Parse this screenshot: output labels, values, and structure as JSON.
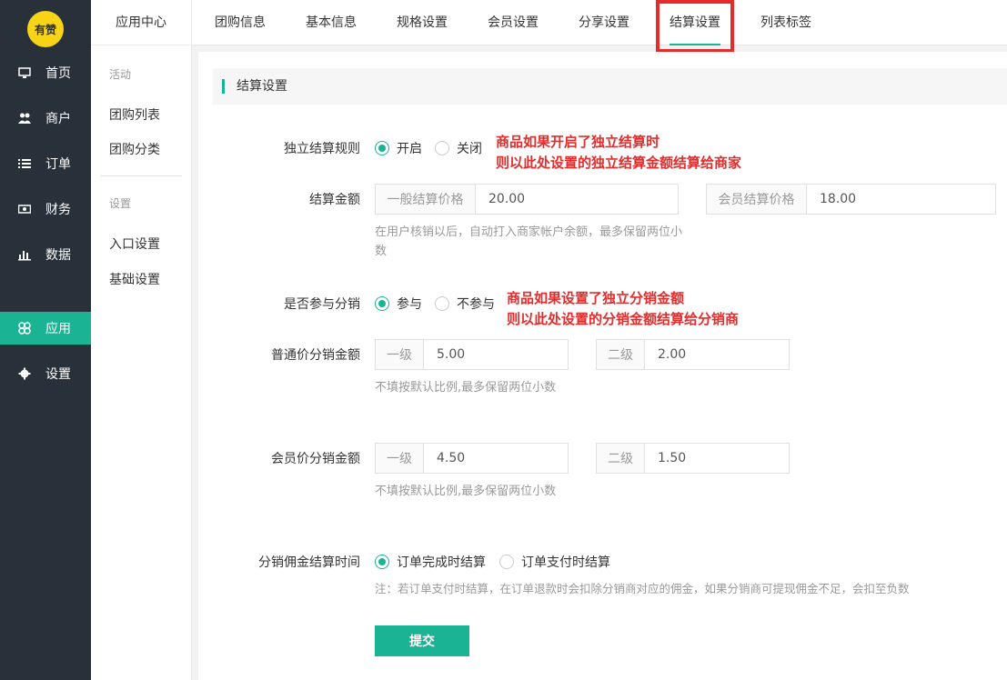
{
  "logo_text": "有赞",
  "nav": [
    {
      "label": "首页",
      "icon": "monitor-icon"
    },
    {
      "label": "商户",
      "icon": "users-icon"
    },
    {
      "label": "订单",
      "icon": "list-icon"
    },
    {
      "label": "财务",
      "icon": "money-icon"
    },
    {
      "label": "数据",
      "icon": "bar-chart-icon"
    },
    {
      "label": "应用",
      "icon": "apps-icon",
      "active": true
    },
    {
      "label": "设置",
      "icon": "gear-icon"
    }
  ],
  "subnav": {
    "title": "应用中心",
    "groups": [
      {
        "label": "活动",
        "items": [
          "团购列表",
          "团购分类"
        ]
      },
      {
        "label": "设置",
        "items": [
          "入口设置",
          "基础设置"
        ]
      }
    ]
  },
  "tabs": [
    "团购信息",
    "基本信息",
    "规格设置",
    "会员设置",
    "分享设置",
    "结算设置",
    "列表标签"
  ],
  "active_tab": "结算设置",
  "section_title": "结算设置",
  "form": {
    "independent_rule": {
      "label": "独立结算规则",
      "options": [
        "开启",
        "关闭"
      ],
      "selected": "开启"
    },
    "settle_amount": {
      "label": "结算金额",
      "normal_prefix": "一般结算价格",
      "normal_value": "20.00",
      "member_prefix": "会员结算价格",
      "member_value": "18.00",
      "hint": "在用户核销以后，自动打入商家帐户余额，最多保留两位小数"
    },
    "distribution": {
      "label": "是否参与分销",
      "options": [
        "参与",
        "不参与"
      ],
      "selected": "参与"
    },
    "normal_dist": {
      "label": "普通价分销金额",
      "level1_prefix": "一级",
      "level1_value": "5.00",
      "level2_prefix": "二级",
      "level2_value": "2.00",
      "hint": "不填按默认比例,最多保留两位小数"
    },
    "member_dist": {
      "label": "会员价分销金额",
      "level1_prefix": "一级",
      "level1_value": "4.50",
      "level2_prefix": "二级",
      "level2_value": "1.50",
      "hint": "不填按默认比例,最多保留两位小数"
    },
    "commission_time": {
      "label": "分销佣金结算时间",
      "options": [
        "订单完成时结算",
        "订单支付时结算"
      ],
      "selected": "订单完成时结算",
      "note": "注：若订单支付时结算，在订单退款时会扣除分销商对应的佣金，如果分销商可提现佣金不足，会扣至负数"
    },
    "submit": "提交"
  },
  "annotations": {
    "a1": [
      "商品如果开启了独立结算时",
      "则以此处设置的独立结算金额结算给商家"
    ],
    "a2": [
      "商品如果设置了独立分销金额",
      "则以此处设置的分销金额结算给分销商"
    ]
  },
  "colors": {
    "accent": "#1ab394",
    "sidebar": "#283039",
    "annotation": "#e52c2c",
    "logo": "#f7d415"
  }
}
